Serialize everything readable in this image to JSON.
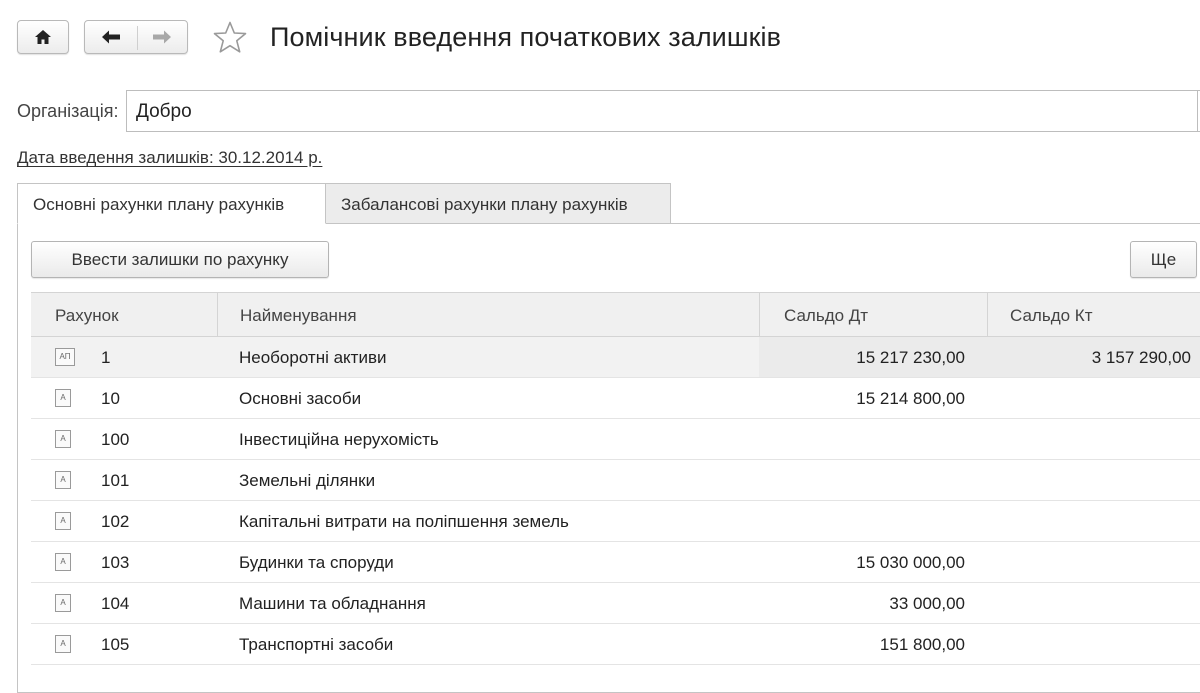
{
  "window": {
    "title": "Помічник введення початкових залишків",
    "home_icon": "home-icon",
    "back_icon": "arrow-left-icon",
    "forward_icon": "arrow-right-icon",
    "favorite_icon": "star-icon"
  },
  "organization": {
    "label": "Організація:",
    "value": "Добро"
  },
  "date_link": "Дата введення залишків: 30.12.2014 р.",
  "tabs": [
    {
      "label": "Основні рахунки плану рахунків",
      "active": true
    },
    {
      "label": "Забалансові рахунки плану рахунків",
      "active": false
    }
  ],
  "toolbar": {
    "enter_button": "Ввести залишки по рахунку",
    "more_button": "Ще"
  },
  "table": {
    "columns": [
      "Рахунок",
      "Найменування",
      "Сальдо Дт",
      "Сальдо Кт"
    ],
    "rows": [
      {
        "icon": "account-group-icon",
        "icon_text": "АП",
        "code": "1",
        "name": "Необоротні активи",
        "dt": "15 217 230,00",
        "kt": "3 157 290,00",
        "selected": true
      },
      {
        "icon": "account-icon",
        "icon_text": "А",
        "code": "10",
        "name": "Основні засоби",
        "dt": "15 214 800,00",
        "kt": ""
      },
      {
        "icon": "account-icon",
        "icon_text": "А",
        "code": "100",
        "name": "Інвестиційна нерухомість",
        "dt": "",
        "kt": ""
      },
      {
        "icon": "account-icon",
        "icon_text": "А",
        "code": "101",
        "name": "Земельні ділянки",
        "dt": "",
        "kt": ""
      },
      {
        "icon": "account-icon",
        "icon_text": "А",
        "code": "102",
        "name": "Капітальні витрати на поліпшення  земель",
        "dt": "",
        "kt": ""
      },
      {
        "icon": "account-icon",
        "icon_text": "А",
        "code": "103",
        "name": "Будинки та споруди",
        "dt": "15 030 000,00",
        "kt": ""
      },
      {
        "icon": "account-icon",
        "icon_text": "А",
        "code": "104",
        "name": "Машини та обладнання",
        "dt": "33 000,00",
        "kt": ""
      },
      {
        "icon": "account-icon",
        "icon_text": "А",
        "code": "105",
        "name": "Транспортні засоби",
        "dt": "151 800,00",
        "kt": ""
      }
    ]
  }
}
